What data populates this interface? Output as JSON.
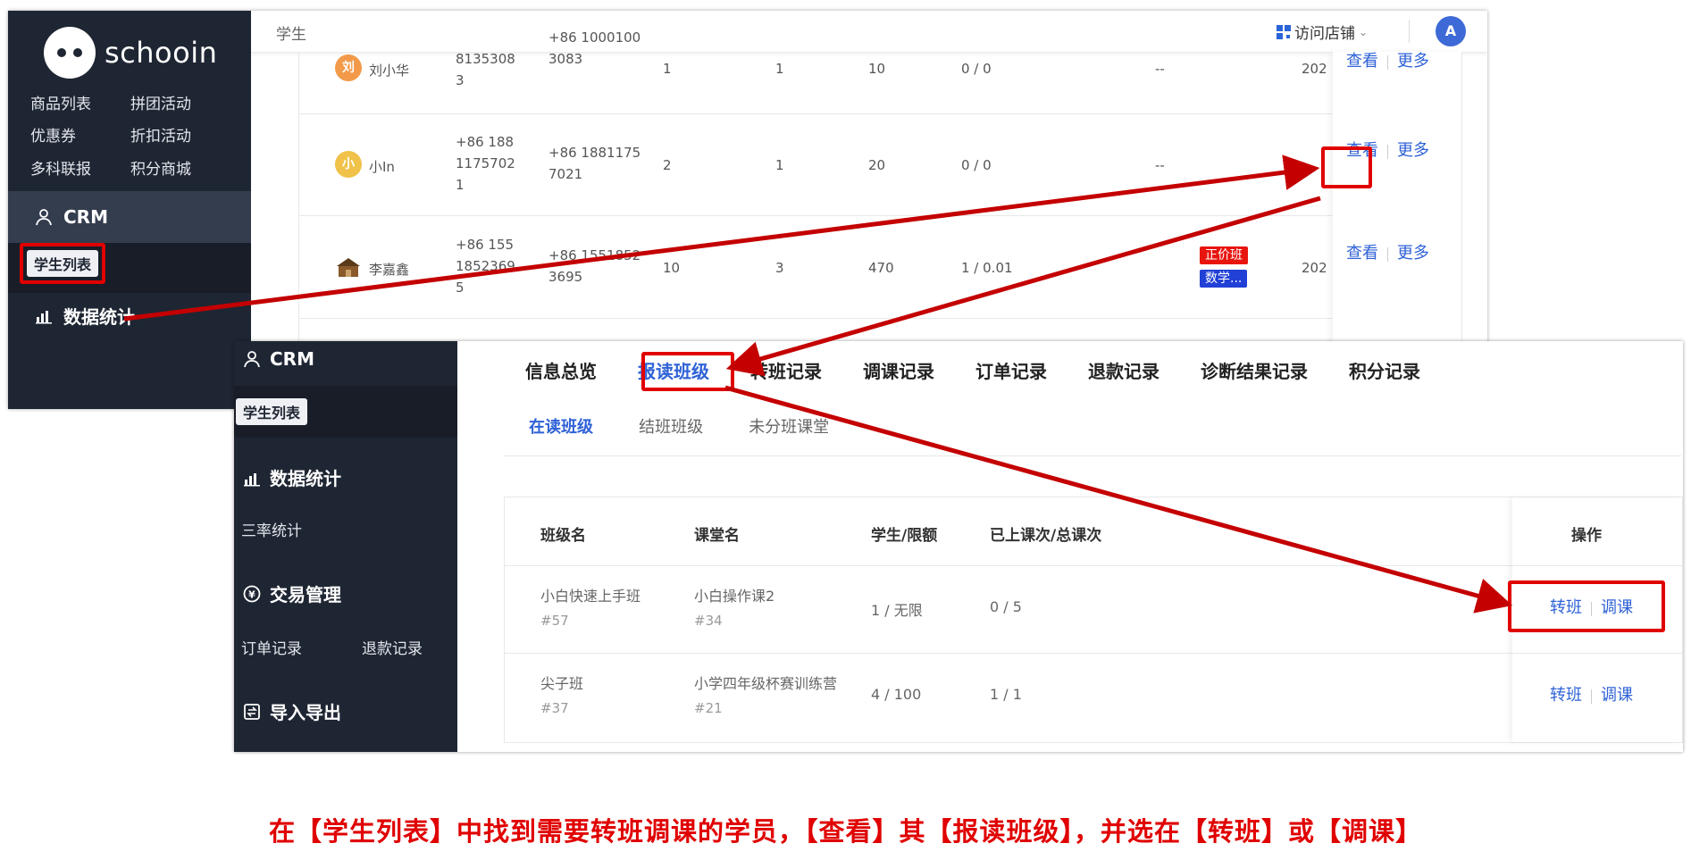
{
  "panel1": {
    "sidebar": {
      "logo_text": "schooin",
      "links": [
        "商品列表",
        "拼团活动",
        "优惠券",
        "折扣活动",
        "多科联报",
        "积分商城"
      ],
      "crm_label": "CRM",
      "active_item": "学生列表",
      "stats_label": "数据统计"
    },
    "header": {
      "title": "学生",
      "shop_link": "访问店铺",
      "avatar": "A"
    },
    "rows": [
      {
        "avatar": "刘",
        "avatar_color": "#f29a4a",
        "name": "刘小华",
        "phone1": [
          "8135308",
          "3"
        ],
        "phone2": [
          "+86 1000100",
          "3083"
        ],
        "c3": "1",
        "c4": "1",
        "c5": "10",
        "c6": "0 / 0",
        "c7": "--",
        "c8": "202",
        "view": "查看",
        "more": "更多"
      },
      {
        "avatar": "小",
        "avatar_color": "#f0c24a",
        "name": "小In",
        "phone1": [
          "+86 188",
          "1175702",
          "1"
        ],
        "phone2": [
          "+86 1881175",
          "7021"
        ],
        "c3": "2",
        "c4": "1",
        "c5": "20",
        "c6": "0 / 0",
        "c7": "--",
        "c8": "",
        "view": "查看",
        "more": "更多"
      },
      {
        "avatar": "",
        "avatar_color": "#8a5a2a",
        "name": "李嘉鑫",
        "phone1": [
          "+86 155",
          "1852369",
          "5"
        ],
        "phone2": [
          "+86 1551852",
          "3695"
        ],
        "c3": "10",
        "c4": "3",
        "c5": "470",
        "c6": "1 / 0.01",
        "tags": [
          {
            "text": "正价班",
            "color": "#e8150f"
          },
          {
            "text": "数学...",
            "color": "#2140d6"
          }
        ],
        "c8": "202",
        "view": "查看",
        "more": "更多"
      }
    ]
  },
  "panel2": {
    "sidebar": {
      "crm_label": "CRM",
      "active_item": "学生列表",
      "stats_label": "数据统计",
      "stats_sub": "三率统计",
      "trade_label": "交易管理",
      "trade_links": [
        "订单记录",
        "退款记录"
      ],
      "io_label": "导入导出"
    },
    "tabs": [
      "信息总览",
      "报读班级",
      "转班记录",
      "调课记录",
      "订单记录",
      "退款记录",
      "诊断结果记录",
      "积分记录"
    ],
    "active_tab": "报读班级",
    "subtabs": [
      "在读班级",
      "结班班级",
      "未分班课堂"
    ],
    "active_subtab": "在读班级",
    "table": {
      "headers": [
        "班级名",
        "课堂名",
        "学生/限额",
        "已上课次/总课次",
        "操作"
      ],
      "rows": [
        {
          "class_name": "小白快速上手班",
          "class_id": "#57",
          "course": "小白操作课2",
          "course_id": "#34",
          "students": "1 / 无限",
          "lessons": "0 / 5",
          "op1": "转班",
          "op2": "调课"
        },
        {
          "class_name": "尖子班",
          "class_id": "#37",
          "course": "小学四年级杯赛训练营",
          "course_id": "#21",
          "students": "4 / 100",
          "lessons": "1 / 1",
          "op1": "转班",
          "op2": "调课"
        }
      ]
    }
  },
  "caption": "在【学生列表】中找到需要转班调课的学员，【查看】其【报读班级】，并选在【转班】或【调课】",
  "colors": {
    "sidebar_bg": "#1f2633",
    "link_blue": "#2f62d6",
    "highlight_red": "#e00000"
  }
}
